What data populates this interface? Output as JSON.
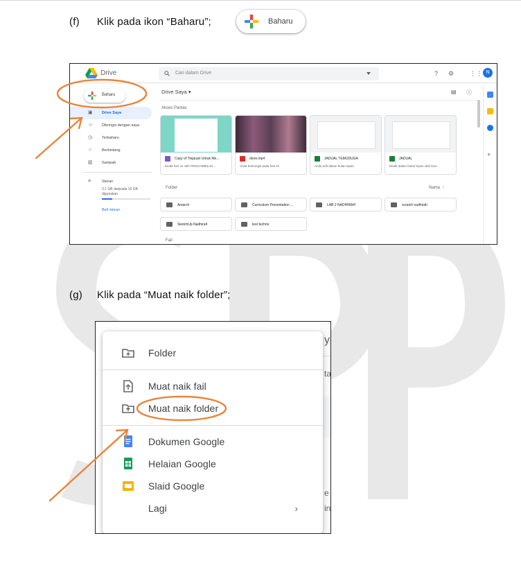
{
  "steps": [
    {
      "num": "(f)",
      "text": "Klik pada ikon “Baharu”;"
    },
    {
      "num": "(g)",
      "text": "Klik pada “Muat naik folder”;"
    }
  ],
  "new_button": {
    "label": "Baharu"
  },
  "watermark": {
    "text": "SPP"
  },
  "drive": {
    "brand": "Drive",
    "search_placeholder": "Cari dalam Drive",
    "avatar": "N",
    "new_label": "Baharu",
    "sidebar": [
      {
        "icon": "drive-icon",
        "label": "Drive Saya",
        "active": true
      },
      {
        "icon": "shared-icon",
        "label": "Dikongsi dengan saya"
      },
      {
        "icon": "clock-icon",
        "label": "Terbaharu"
      },
      {
        "icon": "star-icon",
        "label": "Berbintang"
      },
      {
        "icon": "trash-icon",
        "label": "Sampah"
      },
      {
        "icon": "storage-icon",
        "label": "Storan"
      }
    ],
    "storage_text": "3.1 GB daripada 15 GB digunakan",
    "storage_used_fraction": 0.21,
    "buy_storage": "Beli storan",
    "breadcrumb": "Drive Saya",
    "quick_access": "Akses Pantas",
    "cards": [
      {
        "name": "Copy of Tinjauan Untuk Me...",
        "sub": "Diedit hari ini oleh PENGAMBILAN ...",
        "icon_color": "#7e57c2"
      },
      {
        "name": "done.mp4",
        "sub": "Anda berkongsi pada hari ini",
        "icon_color": "#d93025"
      },
      {
        "name": "JADUAL TEMUDUGA",
        "sub": "Anda edit dalam bulan lepas",
        "icon_color": "#188038"
      },
      {
        "name": "JADUAL",
        "sub": "Diedit dalam bulan lepas oleh Nov...",
        "icon_color": "#188038"
      }
    ],
    "folder_heading": "Folder",
    "sort_label": "Nama",
    "folders": [
      "Amarch",
      "Curriculum Presentation ...",
      "LAB 2 NADHIRAH",
      "scratch nadhirah",
      "SketchUp Nadhirah",
      "test techno"
    ],
    "files_heading": "Fail"
  },
  "menu": {
    "items": [
      {
        "icon": "new-folder-icon",
        "label": "Folder"
      },
      {
        "icon": "file-upload-icon",
        "label": "Muat naik fail"
      },
      {
        "icon": "folder-upload-icon",
        "label": "Muat naik folder"
      },
      {
        "icon": "google-docs-icon",
        "label": "Dokumen Google",
        "color": "#4285f4"
      },
      {
        "icon": "google-sheets-icon",
        "label": "Helaian Google",
        "color": "#0f9d58"
      },
      {
        "icon": "google-slides-icon",
        "label": "Slaid Google",
        "color": "#f4b400"
      },
      {
        "icon": "more-icon",
        "label": "Lagi"
      }
    ],
    "chevron": "›"
  },
  "colors": {
    "highlight": "#e8843a",
    "brand_blue": "#4285f4"
  }
}
